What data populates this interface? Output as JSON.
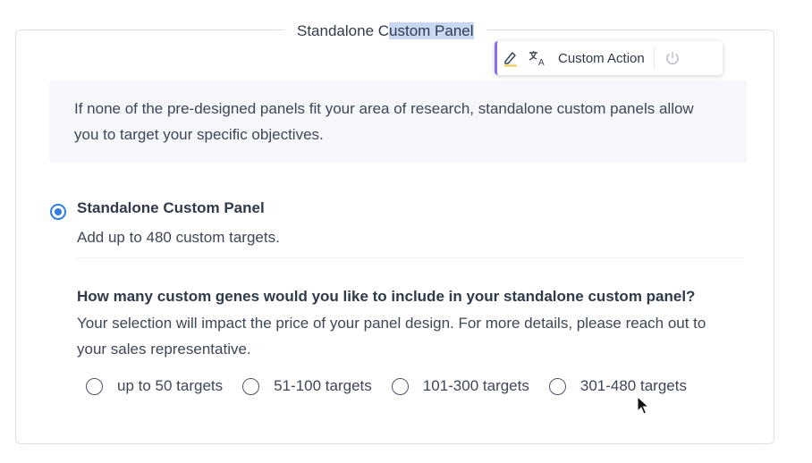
{
  "panel": {
    "legend_before": "Standalone C",
    "legend_selected": "ustom Panel",
    "intro_text": "If none of the pre-designed panels fit your area of research, standalone custom panels allow you to target your specific objectives."
  },
  "toolbar": {
    "highlight_icon": "highlighter-icon",
    "translate_icon": "translate-icon",
    "custom_action_label": "Custom Action",
    "power_icon": "power-icon",
    "accent_color": "#8a6cf0"
  },
  "option": {
    "title": "Standalone Custom Panel",
    "description": "Add up to 480 custom targets.",
    "selected": true
  },
  "question": {
    "title": "How many custom genes would you like to include in your standalone custom panel?",
    "help": "Your selection will impact the price of your panel design. For more details, please reach out to your sales representative."
  },
  "choices": [
    {
      "label": "up to 50 targets",
      "selected": false
    },
    {
      "label": "51-100 targets",
      "selected": false
    },
    {
      "label": "101-300 targets",
      "selected": false
    },
    {
      "label": "301-480 targets",
      "selected": false
    }
  ],
  "colors": {
    "radio_selected": "#2f7de1",
    "text_primary": "#2f3a4a",
    "intro_background": "#f6f7fb",
    "selection_highlight": "#c9d8f2"
  }
}
